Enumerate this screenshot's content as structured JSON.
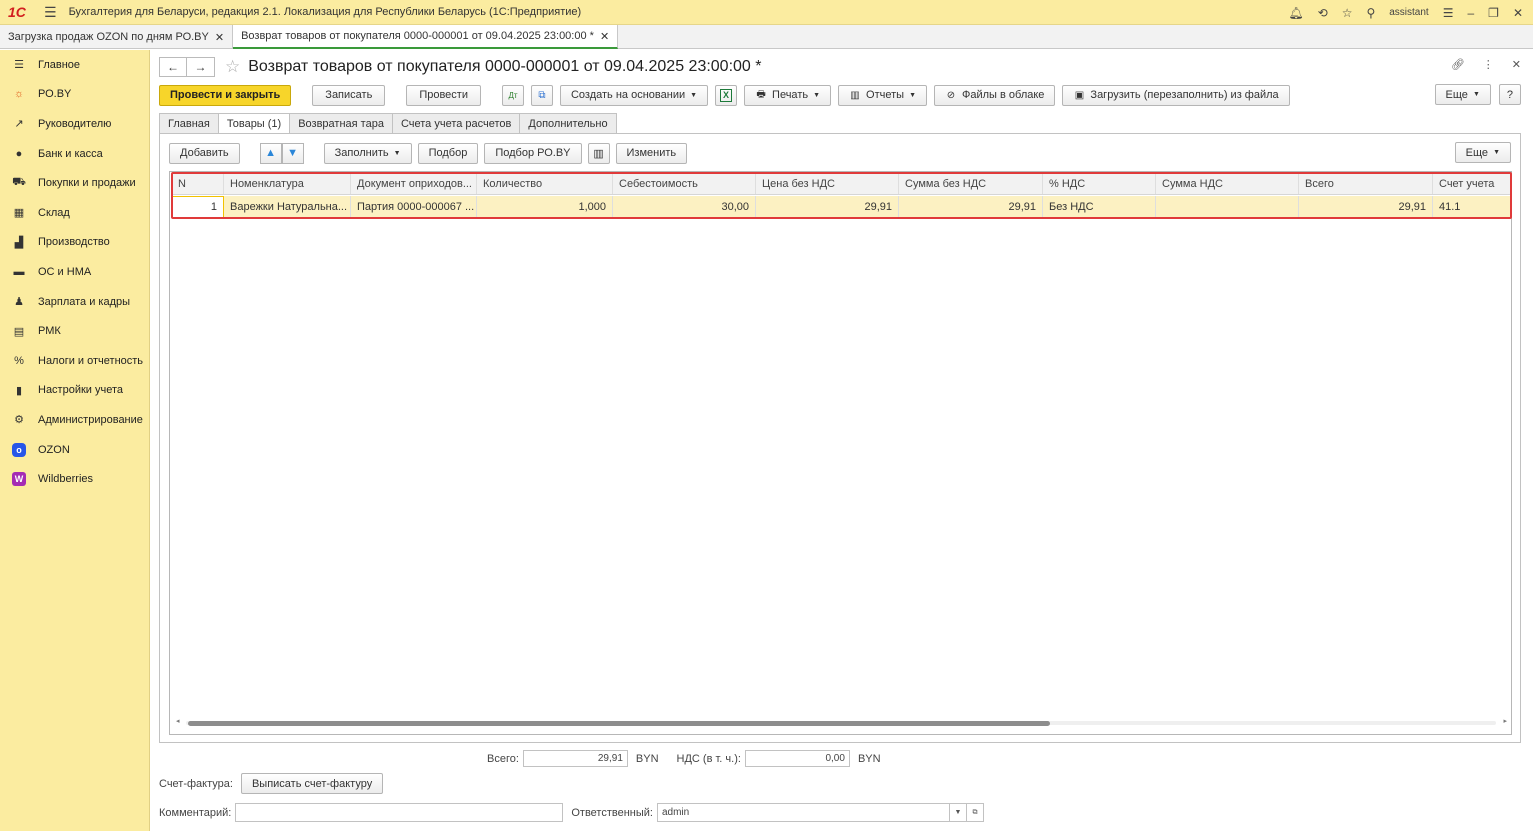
{
  "app": {
    "logo": "1С",
    "title": "Бухгалтерия для Беларуси, редакция 2.1. Локализация для Республики Беларусь  (1С:Предприятие)",
    "user": "assistant"
  },
  "open_tabs": [
    {
      "label": "Загрузка продаж OZON по дням РО.BY"
    },
    {
      "label": "Возврат товаров от покупателя 0000-000001 от 09.04.2025 23:00:00 *"
    }
  ],
  "sidebar": {
    "items": [
      {
        "label": "Главное",
        "icon": "menu-icon"
      },
      {
        "label": "РО.BY",
        "icon": "sun-icon"
      },
      {
        "label": "Руководителю",
        "icon": "trend-icon"
      },
      {
        "label": "Банк и касса",
        "icon": "coin-icon"
      },
      {
        "label": "Покупки и продажи",
        "icon": "cart-icon"
      },
      {
        "label": "Склад",
        "icon": "grid-icon"
      },
      {
        "label": "Производство",
        "icon": "factory-icon"
      },
      {
        "label": "ОС и НМА",
        "icon": "truck-icon"
      },
      {
        "label": "Зарплата и кадры",
        "icon": "person-icon"
      },
      {
        "label": "РМК",
        "icon": "register-icon"
      },
      {
        "label": "Налоги и отчетность",
        "icon": "tax-icon"
      },
      {
        "label": "Настройки учета",
        "icon": "book-icon"
      },
      {
        "label": "Администрирование",
        "icon": "gear-icon"
      },
      {
        "label": "OZON",
        "icon": "ozon-icon"
      },
      {
        "label": "Wildberries",
        "icon": "wildberries-icon"
      }
    ]
  },
  "form": {
    "title": "Возврат товаров от покупателя 0000-000001 от 09.04.2025 23:00:00 *",
    "toolbar": {
      "post_and_close": "Провести и закрыть",
      "save": "Записать",
      "post": "Провести",
      "create_based_on": "Создать на основании",
      "print": "Печать",
      "reports": "Отчеты",
      "cloud_files": "Файлы в облаке",
      "load_from_file": "Загрузить (перезаполнить) из файла",
      "more": "Еще",
      "help": "?"
    },
    "tabs": [
      {
        "label": "Главная"
      },
      {
        "label": "Товары (1)"
      },
      {
        "label": "Возвратная тара"
      },
      {
        "label": "Счета учета расчетов"
      },
      {
        "label": "Дополнительно"
      }
    ],
    "goods": {
      "toolbar": {
        "add": "Добавить",
        "fill": "Заполнить",
        "pick": "Подбор",
        "pick_roby": "Подбор РО.BY",
        "change": "Изменить",
        "more": "Еще"
      },
      "columns": [
        "N",
        "Номенклатура",
        "Документ оприходов...",
        "Количество",
        "Себестоимость",
        "Цена без НДС",
        "Сумма без НДС",
        "% НДС",
        "Сумма НДС",
        "Всего",
        "Счет учета"
      ],
      "rows": [
        [
          "1",
          "Варежки Натуральна...",
          "Партия 0000-000067 ...",
          "1,000",
          "30,00",
          "29,91",
          "29,91",
          "Без НДС",
          "",
          "29,91",
          "41.1"
        ]
      ]
    },
    "totals": {
      "total_label": "Всего:",
      "total_value": "29,91",
      "currency": "BYN",
      "vat_label": "НДС (в т. ч.):",
      "vat_value": "0,00",
      "vat_currency": "BYN"
    },
    "invoice": {
      "label": "Счет-фактура:",
      "button": "Выписать счет-фактуру"
    },
    "comment": {
      "label": "Комментарий:",
      "value": ""
    },
    "responsible": {
      "label": "Ответственный:",
      "value": "admin"
    }
  }
}
